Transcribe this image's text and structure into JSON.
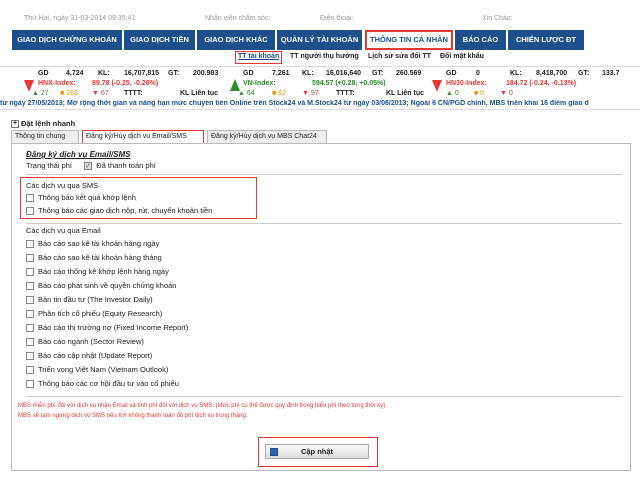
{
  "topinfo": {
    "date": "Thứ Hai, ngày 31-03-2014 09:35:41",
    "staff": "Nhân viên chăm sóc:",
    "phone": "Điện thoại:",
    "greeting": "Xin Chào:"
  },
  "nav": {
    "items": [
      {
        "label": "GIAO DỊCH CHỨNG KHOÁN"
      },
      {
        "label": "GIAO DỊCH TIỀN"
      },
      {
        "label": "GIAO DỊCH KHÁC"
      },
      {
        "label": "QUẢN LÝ TÀI KHOẢN"
      },
      {
        "label": "THÔNG TIN CÁ NHÂN"
      },
      {
        "label": "BÁO CÁO"
      },
      {
        "label": "CHIẾN LƯỢC ĐT"
      }
    ]
  },
  "subnav": {
    "items": [
      {
        "label": "TT tài khoản"
      },
      {
        "label": "TT người thụ hưởng"
      },
      {
        "label": "Lịch sử sửa đổi TT"
      },
      {
        "label": "Đổi mật khẩu"
      }
    ]
  },
  "ticker": {
    "hnx": {
      "gd_label": "GD",
      "gd": "4,724",
      "kl_label": "KL:",
      "kl": "16,707,815",
      "gt_label": "GT:",
      "gt": "200.983",
      "name": "HNX-Index:",
      "value": "89.78 (-0.25, -0.28%)",
      "up": "▲ 27",
      "flat": "■ 263",
      "down": "▼ 67",
      "tttt": "TTTT:",
      "kl_status": "KL Liên tục"
    },
    "vn": {
      "gd_label": "GD",
      "gd": "7,261",
      "kl_label": "KL:",
      "kl": "16,016,640",
      "gt_label": "GT:",
      "gt": "260.569",
      "name": "VN-Index:",
      "value": "594.57 (+0.28, +0.05%)",
      "up": "▲ 64",
      "flat": "■ 62",
      "down": "▼ 97",
      "tttt": "TTTT:",
      "kl_status": "KL Liên tục"
    },
    "hn30": {
      "gd_label": "GD",
      "gd": "0",
      "kl_label": "KL:",
      "kl": "8,418,700",
      "gt_label": "GT:",
      "gt": "133.7",
      "name": "HN30-Index:",
      "value": "184.72 (-0.24, -0.13%)",
      "up": "▲ 0",
      "flat": "■ 0",
      "down": "▼ 0"
    }
  },
  "marquee": "từ ngày 27/05/2013; Mở rộng thời gian và nâng hạn mức chuyển tiền Online trên Stock24 và M.Stock24 từ ngày 03/06/2013; Ngoài 6 CN/PGD chính, MBS triển khai 16 điểm giao d",
  "quick_order": "Đặt lệnh nhanh",
  "tabs": [
    {
      "label": "Thông tin chung"
    },
    {
      "label": "Đăng ký/Hủy dịch vụ Email/SMS"
    },
    {
      "label": "Đăng ký/Hủy dịch vụ MBS Chat24"
    }
  ],
  "panel": {
    "heading": "Đăng ký dịch vụ Email/SMS",
    "fee_status_label": "Trạng thái phí",
    "fee_paid": "Đã thanh toán phí",
    "sms_header": "Các dịch vụ qua SMS",
    "sms_items": [
      "Thông báo kết quả khớp lệnh",
      "Thông báo các giao dịch nộp, rút, chuyển khoản tiền"
    ],
    "email_header": "Các dịch vụ qua Email",
    "email_items": [
      "Báo cáo sao kê tài khoản hàng ngày",
      "Báo cáo sao kê tài khoản hàng tháng",
      "Báo cáo thống kê khớp lệnh hàng ngày",
      "Báo cáo phát sinh về quyền chứng khoán",
      "Bản tin đầu tư (The Investor Daily)",
      "Phân tích cổ phiếu (Equity Research)",
      "Báo cáo thị trường nợ (Fixed Income Report)",
      "Báo cáo ngành (Sector Review)",
      "Báo cáo cập nhật (Update Report)",
      "Triển vọng Việt Nam (Vietnam Outlook)",
      "Thông báo các cơ hội đầu tư vào cổ phiếu"
    ],
    "note1": "MBS miễn phí đối với dịch vụ nhận Email và tính phí đối với dịch vụ SMS. (Mức phí cụ thể được quy định trong biểu phí theo từng thời kỳ).",
    "note2": "MBS sẽ tạm ngưng dịch vụ SMS nếu KH không thanh toán đủ phí dịch vụ trong tháng.",
    "update_label": "Cập nhật"
  }
}
